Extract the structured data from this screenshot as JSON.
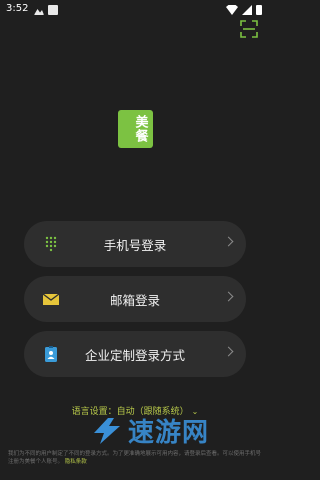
{
  "status": {
    "time": "3:52"
  },
  "logo": {
    "text": "美餐"
  },
  "login_options": [
    {
      "label": "手机号登录",
      "icon": "dialpad-icon"
    },
    {
      "label": "邮箱登录",
      "icon": "envelope-icon"
    },
    {
      "label": "企业定制登录方式",
      "icon": "badge-icon"
    }
  ],
  "language": {
    "label": "语言设置：自动（跟随系统）"
  },
  "footer": {
    "text": "我们为不同的用户制定了不同的登录方式。为了更准确地展示可用内容，请登录后查看。可以使用手机号注册为美餐个人账号。",
    "link": "隐私条款"
  },
  "watermark": {
    "text": "速游网"
  },
  "colors": {
    "accent_green": "#7cc242",
    "button_bg": "#2e2e2e",
    "background": "#1f1f1f",
    "link_yellow_green": "#b8c94a"
  }
}
